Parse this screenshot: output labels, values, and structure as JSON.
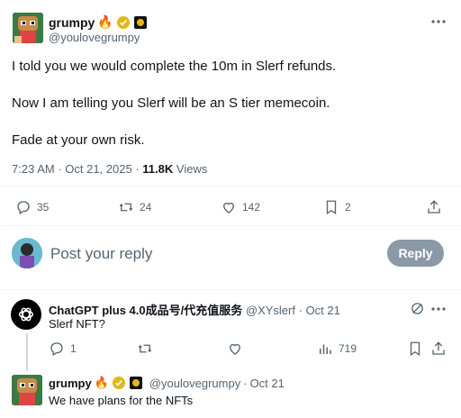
{
  "post": {
    "author_name": "grumpy",
    "author_emoji": "🔥",
    "handle": "@youlovegrumpy",
    "lines": [
      "I told you we would complete the 10m in Slerf refunds.",
      "Now I am telling you Slerf will be an S tier memecoin.",
      "Fade at your own risk."
    ],
    "time": "7:23 AM",
    "date": "Oct 21, 2025",
    "views_count": "11.8K",
    "views_label": "Views",
    "stats": {
      "replies": "35",
      "reposts": "24",
      "likes": "142",
      "bookmarks": "2"
    }
  },
  "composer": {
    "placeholder": "Post your reply",
    "button": "Reply"
  },
  "replies": [
    {
      "name": "ChatGPT plus 4.0成品号/代充值服务",
      "handle": "@XYslerf",
      "date": "Oct 21",
      "text": "Slerf NFT?",
      "stats": {
        "replies": "1",
        "views": "719"
      }
    },
    {
      "name": "grumpy",
      "emoji": "🔥",
      "handle": "@youlovegrumpy",
      "date": "Oct 21",
      "text": "We have plans for the NFTs"
    }
  ],
  "colors": {
    "text": "#0f1419",
    "muted": "#536471",
    "verified": "#e2b719",
    "reply_button": "#8b98a5"
  },
  "icons": [
    "more-icon",
    "verified-icon",
    "affiliate-badge-icon",
    "reply-icon",
    "repost-icon",
    "like-icon",
    "bookmark-icon",
    "share-icon",
    "views-icon",
    "grok-icon"
  ]
}
